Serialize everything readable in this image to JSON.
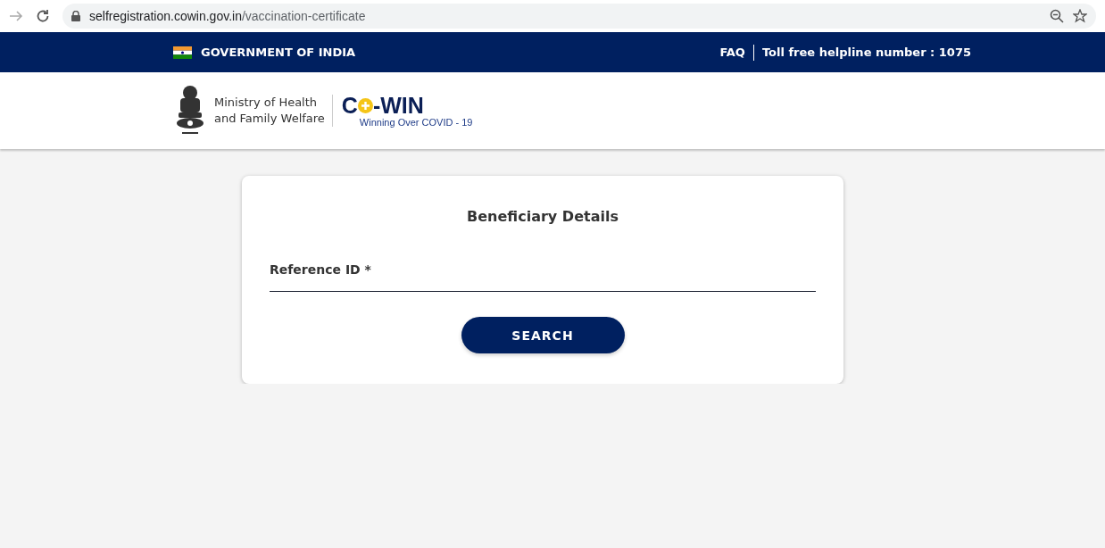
{
  "browser": {
    "url_host": "selfregistration.cowin.gov.in",
    "url_path": "/vaccination-certificate"
  },
  "top_bar": {
    "title": "GOVERNMENT OF INDIA",
    "links": [
      {
        "label": "FAQ"
      },
      {
        "label": "Toll free helpline number : 1075"
      }
    ]
  },
  "header": {
    "ministry": [
      "Ministry of Health",
      "and Family Welfare"
    ],
    "logo": {
      "start": "C",
      "end": "-WIN",
      "tagline": "Winning Over COVID - 19"
    }
  },
  "card": {
    "title": "Beneficiary Details",
    "field": {
      "label": "Reference ID *"
    },
    "button": "SEARCH"
  }
}
